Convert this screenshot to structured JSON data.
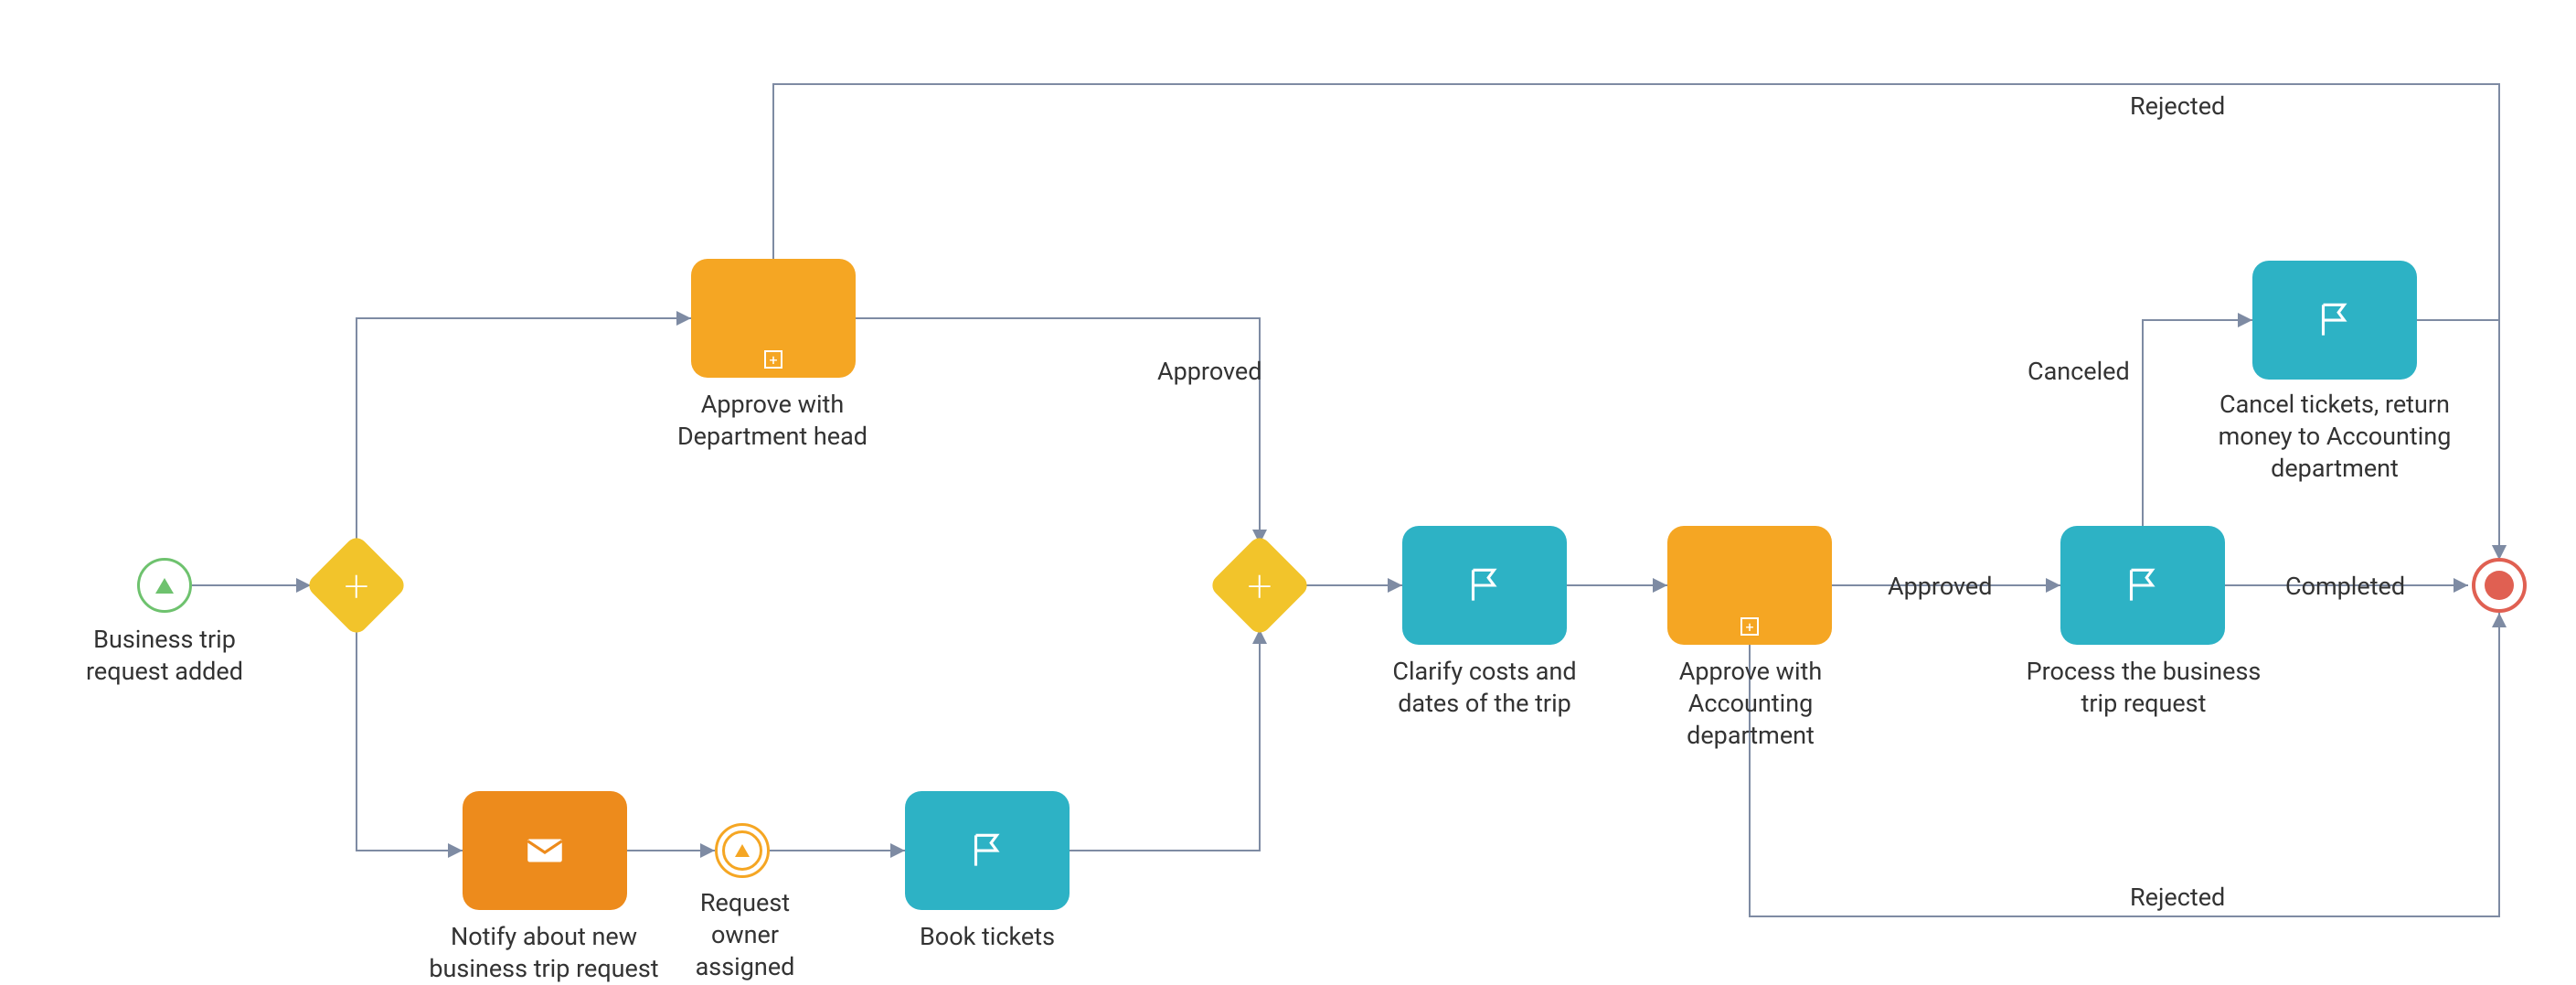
{
  "nodes": {
    "start": {
      "label": "Business trip request added"
    },
    "gateway1": {
      "type": "parallel"
    },
    "approve_dept": {
      "label": "Approve with Department head"
    },
    "notify": {
      "label": "Notify about new business trip request"
    },
    "owner_assigned": {
      "label": "Request owner assigned"
    },
    "book_tickets": {
      "label": "Book tickets"
    },
    "gateway2": {
      "type": "parallel"
    },
    "clarify": {
      "label": "Clarify costs and dates of the trip"
    },
    "approve_acct": {
      "label": "Approve with Accounting department"
    },
    "process_req": {
      "label": "Process the business trip request"
    },
    "cancel_tickets": {
      "label": "Cancel tickets, return money to Accounting department"
    },
    "end": {
      "type": "end"
    }
  },
  "edges": {
    "approve_dept_approved": "Approved",
    "approve_dept_rejected": "Rejected",
    "approve_acct_approved": "Approved",
    "approve_acct_rejected": "Rejected",
    "process_completed": "Completed",
    "process_canceled": "Canceled"
  }
}
